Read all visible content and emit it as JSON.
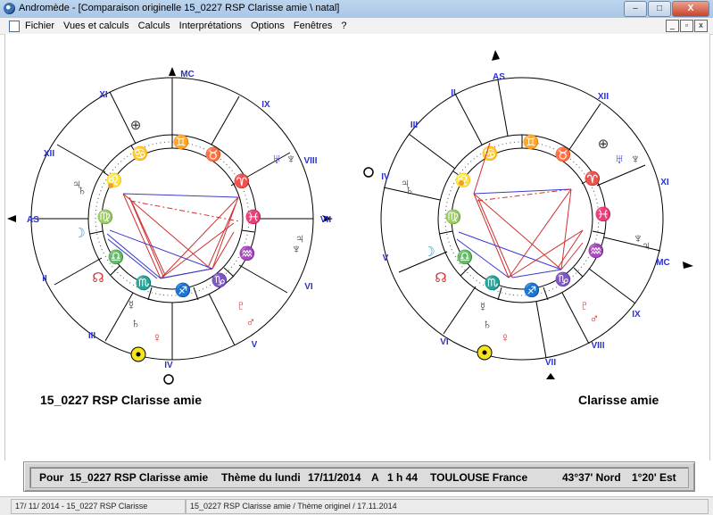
{
  "window": {
    "title": "Andromède - [Comparaison originelle 15_0227 RSP Clarisse amie \\ natal]",
    "buttons": [
      "–",
      "□",
      "X"
    ]
  },
  "menubar": {
    "items": [
      "Fichier",
      "Vues et calculs",
      "Calculs",
      "Interprétations",
      "Options",
      "Fenêtres",
      "?"
    ],
    "mdi_buttons": [
      "_",
      "▫",
      "x"
    ]
  },
  "left_chart": {
    "name": "15_0227 RSP Clarisse amie",
    "angles": [
      "MC",
      "AS",
      "IV",
      "VII"
    ],
    "houses": [
      "XI",
      "IX",
      "XII",
      "VIII",
      "II",
      "VI",
      "III",
      "V"
    ]
  },
  "right_chart": {
    "name": "Clarisse amie",
    "angles": [
      "AS",
      "MC",
      "VII",
      "IV"
    ],
    "houses": [
      "II",
      "XII",
      "III",
      "XI",
      "V",
      "IX",
      "VI",
      "VIII"
    ]
  },
  "colors": {
    "house_label": "#2c32c8",
    "aspect_red": "#d03030",
    "aspect_blue": "#3a3ad0",
    "sun_fill": "#f7e41a",
    "water": "#27a0d8",
    "earth": "#3a9a3a"
  },
  "info": {
    "pour": "Pour",
    "subject": "15_0227 RSP Clarisse amie",
    "theme": "Thème du lundi",
    "date": "17/11/2014",
    "at": "A",
    "time": "1 h 44",
    "place": "TOULOUSE France",
    "lat": "43°37' Nord",
    "lon": "1°20' Est"
  },
  "status": {
    "left": "17/ 11/ 2014 - 15_0227 RSP Clarisse",
    "right": "15_0227 RSP Clarisse amie / Thème originel / 17.11.2014"
  }
}
